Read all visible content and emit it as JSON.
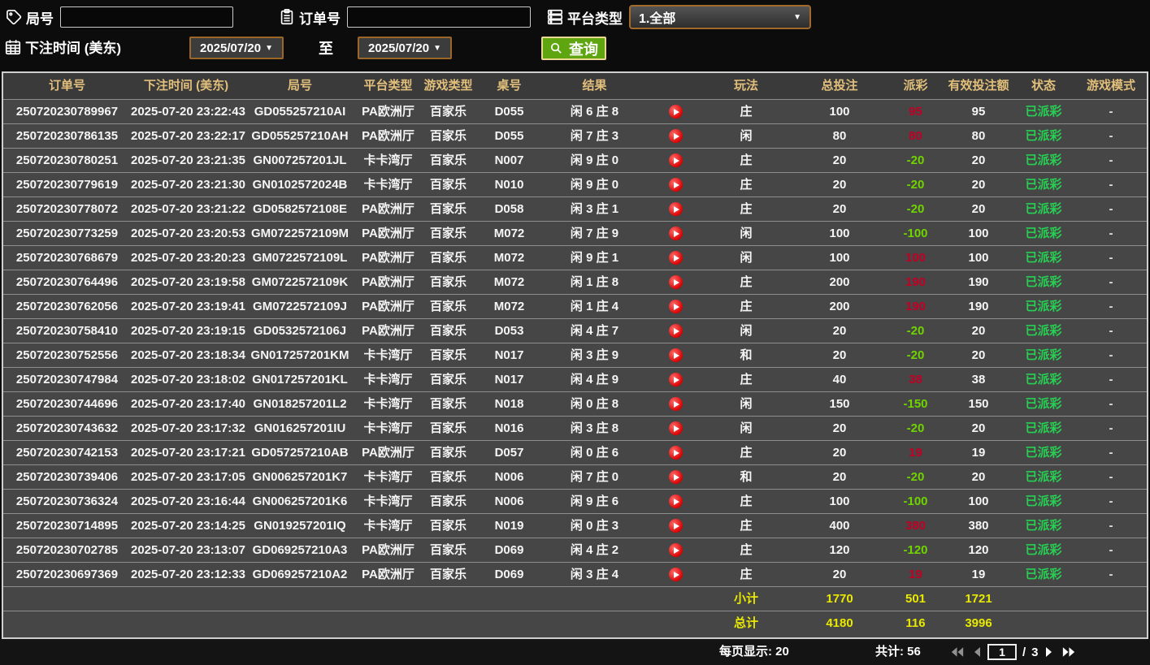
{
  "ui": {
    "caret_down": "▼"
  },
  "filters": {
    "round": {
      "label": "局号",
      "value": "",
      "icon": "tag-icon"
    },
    "order": {
      "label": "订单号",
      "value": "",
      "icon": "clipboard-icon"
    },
    "platform": {
      "label": "平台类型",
      "value": "1.全部",
      "icon": "server-icon"
    },
    "bet_time": {
      "label": "下注时间 (美东)",
      "from": "2025/07/20",
      "to_separator": "至",
      "to": "2025/07/20",
      "icon": "calendar-icon"
    },
    "search": {
      "label": "查询",
      "icon": "magnifier-icon"
    }
  },
  "table": {
    "headers": [
      "订单号",
      "下注时间 (美东)",
      "局号",
      "平台类型",
      "游戏类型",
      "桌号",
      "结果",
      "玩法",
      "总投注",
      "派彩",
      "有效投注额",
      "状态",
      "游戏模式"
    ],
    "rows": [
      {
        "order": "250720230789967",
        "time": "2025-07-20 23:22:43",
        "round": "GD055257210AI",
        "platform": "PA欧洲厅",
        "game": "百家乐",
        "table": "D055",
        "result": "闲 6 庄 8",
        "play": "庄",
        "total_bet": "100",
        "payout": "95",
        "valid_bet": "95",
        "status": "已派彩",
        "mode": "-"
      },
      {
        "order": "250720230786135",
        "time": "2025-07-20 23:22:17",
        "round": "GD055257210AH",
        "platform": "PA欧洲厅",
        "game": "百家乐",
        "table": "D055",
        "result": "闲 7 庄 3",
        "play": "闲",
        "total_bet": "80",
        "payout": "80",
        "valid_bet": "80",
        "status": "已派彩",
        "mode": "-"
      },
      {
        "order": "250720230780251",
        "time": "2025-07-20 23:21:35",
        "round": "GN007257201JL",
        "platform": "卡卡湾厅",
        "game": "百家乐",
        "table": "N007",
        "result": "闲 9 庄 0",
        "play": "庄",
        "total_bet": "20",
        "payout": "-20",
        "valid_bet": "20",
        "status": "已派彩",
        "mode": "-"
      },
      {
        "order": "250720230779619",
        "time": "2025-07-20 23:21:30",
        "round": "GN0102572024B",
        "platform": "卡卡湾厅",
        "game": "百家乐",
        "table": "N010",
        "result": "闲 9 庄 0",
        "play": "庄",
        "total_bet": "20",
        "payout": "-20",
        "valid_bet": "20",
        "status": "已派彩",
        "mode": "-"
      },
      {
        "order": "250720230778072",
        "time": "2025-07-20 23:21:22",
        "round": "GD0582572108E",
        "platform": "PA欧洲厅",
        "game": "百家乐",
        "table": "D058",
        "result": "闲 3 庄 1",
        "play": "庄",
        "total_bet": "20",
        "payout": "-20",
        "valid_bet": "20",
        "status": "已派彩",
        "mode": "-"
      },
      {
        "order": "250720230773259",
        "time": "2025-07-20 23:20:53",
        "round": "GM0722572109M",
        "platform": "PA欧洲厅",
        "game": "百家乐",
        "table": "M072",
        "result": "闲 7 庄 9",
        "play": "闲",
        "total_bet": "100",
        "payout": "-100",
        "valid_bet": "100",
        "status": "已派彩",
        "mode": "-"
      },
      {
        "order": "250720230768679",
        "time": "2025-07-20 23:20:23",
        "round": "GM0722572109L",
        "platform": "PA欧洲厅",
        "game": "百家乐",
        "table": "M072",
        "result": "闲 9 庄 1",
        "play": "闲",
        "total_bet": "100",
        "payout": "100",
        "valid_bet": "100",
        "status": "已派彩",
        "mode": "-"
      },
      {
        "order": "250720230764496",
        "time": "2025-07-20 23:19:58",
        "round": "GM0722572109K",
        "platform": "PA欧洲厅",
        "game": "百家乐",
        "table": "M072",
        "result": "闲 1 庄 8",
        "play": "庄",
        "total_bet": "200",
        "payout": "190",
        "valid_bet": "190",
        "status": "已派彩",
        "mode": "-"
      },
      {
        "order": "250720230762056",
        "time": "2025-07-20 23:19:41",
        "round": "GM0722572109J",
        "platform": "PA欧洲厅",
        "game": "百家乐",
        "table": "M072",
        "result": "闲 1 庄 4",
        "play": "庄",
        "total_bet": "200",
        "payout": "190",
        "valid_bet": "190",
        "status": "已派彩",
        "mode": "-"
      },
      {
        "order": "250720230758410",
        "time": "2025-07-20 23:19:15",
        "round": "GD0532572106J",
        "platform": "PA欧洲厅",
        "game": "百家乐",
        "table": "D053",
        "result": "闲 4 庄 7",
        "play": "闲",
        "total_bet": "20",
        "payout": "-20",
        "valid_bet": "20",
        "status": "已派彩",
        "mode": "-"
      },
      {
        "order": "250720230752556",
        "time": "2025-07-20 23:18:34",
        "round": "GN017257201KM",
        "platform": "卡卡湾厅",
        "game": "百家乐",
        "table": "N017",
        "result": "闲 3 庄 9",
        "play": "和",
        "total_bet": "20",
        "payout": "-20",
        "valid_bet": "20",
        "status": "已派彩",
        "mode": "-"
      },
      {
        "order": "250720230747984",
        "time": "2025-07-20 23:18:02",
        "round": "GN017257201KL",
        "platform": "卡卡湾厅",
        "game": "百家乐",
        "table": "N017",
        "result": "闲 4 庄 9",
        "play": "庄",
        "total_bet": "40",
        "payout": "38",
        "valid_bet": "38",
        "status": "已派彩",
        "mode": "-"
      },
      {
        "order": "250720230744696",
        "time": "2025-07-20 23:17:40",
        "round": "GN018257201L2",
        "platform": "卡卡湾厅",
        "game": "百家乐",
        "table": "N018",
        "result": "闲 0 庄 8",
        "play": "闲",
        "total_bet": "150",
        "payout": "-150",
        "valid_bet": "150",
        "status": "已派彩",
        "mode": "-"
      },
      {
        "order": "250720230743632",
        "time": "2025-07-20 23:17:32",
        "round": "GN016257201IU",
        "platform": "卡卡湾厅",
        "game": "百家乐",
        "table": "N016",
        "result": "闲 3 庄 8",
        "play": "闲",
        "total_bet": "20",
        "payout": "-20",
        "valid_bet": "20",
        "status": "已派彩",
        "mode": "-"
      },
      {
        "order": "250720230742153",
        "time": "2025-07-20 23:17:21",
        "round": "GD057257210AB",
        "platform": "PA欧洲厅",
        "game": "百家乐",
        "table": "D057",
        "result": "闲 0 庄 6",
        "play": "庄",
        "total_bet": "20",
        "payout": "19",
        "valid_bet": "19",
        "status": "已派彩",
        "mode": "-"
      },
      {
        "order": "250720230739406",
        "time": "2025-07-20 23:17:05",
        "round": "GN006257201K7",
        "platform": "卡卡湾厅",
        "game": "百家乐",
        "table": "N006",
        "result": "闲 7 庄 0",
        "play": "和",
        "total_bet": "20",
        "payout": "-20",
        "valid_bet": "20",
        "status": "已派彩",
        "mode": "-"
      },
      {
        "order": "250720230736324",
        "time": "2025-07-20 23:16:44",
        "round": "GN006257201K6",
        "platform": "卡卡湾厅",
        "game": "百家乐",
        "table": "N006",
        "result": "闲 9 庄 6",
        "play": "庄",
        "total_bet": "100",
        "payout": "-100",
        "valid_bet": "100",
        "status": "已派彩",
        "mode": "-"
      },
      {
        "order": "250720230714895",
        "time": "2025-07-20 23:14:25",
        "round": "GN019257201IQ",
        "platform": "卡卡湾厅",
        "game": "百家乐",
        "table": "N019",
        "result": "闲 0 庄 3",
        "play": "庄",
        "total_bet": "400",
        "payout": "380",
        "valid_bet": "380",
        "status": "已派彩",
        "mode": "-"
      },
      {
        "order": "250720230702785",
        "time": "2025-07-20 23:13:07",
        "round": "GD069257210A3",
        "platform": "PA欧洲厅",
        "game": "百家乐",
        "table": "D069",
        "result": "闲 4 庄 2",
        "play": "庄",
        "total_bet": "120",
        "payout": "-120",
        "valid_bet": "120",
        "status": "已派彩",
        "mode": "-"
      },
      {
        "order": "250720230697369",
        "time": "2025-07-20 23:12:33",
        "round": "GD069257210A2",
        "platform": "PA欧洲厅",
        "game": "百家乐",
        "table": "D069",
        "result": "闲 3 庄 4",
        "play": "庄",
        "total_bet": "20",
        "payout": "19",
        "valid_bet": "19",
        "status": "已派彩",
        "mode": "-"
      }
    ],
    "subtotal": {
      "label": "小计",
      "total_bet": "1770",
      "payout": "501",
      "valid_bet": "1721"
    },
    "grand_total": {
      "label": "总计",
      "total_bet": "4180",
      "payout": "116",
      "valid_bet": "3996"
    }
  },
  "footer": {
    "per_page": "每页显示: 20",
    "total_count": "共计: 56",
    "page": "1",
    "separator": "/",
    "pages": "3"
  },
  "colors": {
    "header_gold": "#e2bf7b",
    "payout_win_red": "#c10025",
    "payout_loss_green": "#6fd400",
    "status_green": "#27cf52",
    "totals_yellow": "#e9e900",
    "search_button_green": "#5ea510",
    "picker_border_orange": "#9c6626"
  }
}
